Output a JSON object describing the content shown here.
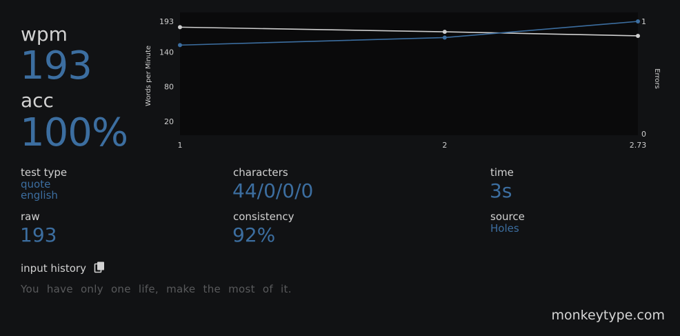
{
  "main": {
    "wpm_label": "wpm",
    "wpm_value": "193",
    "acc_label": "acc",
    "acc_value": "100%"
  },
  "chart_data": {
    "type": "line",
    "x": [
      1,
      2,
      2.73
    ],
    "x_tick_labels": [
      "1",
      "2",
      "2.73"
    ],
    "ylabel": "Words per Minute",
    "y_ticks": [
      "193",
      "140",
      "80",
      "20"
    ],
    "ylim": [
      0,
      200
    ],
    "y2label": "Errors",
    "y2_ticks": [
      "1",
      "0"
    ],
    "y2lim": [
      0,
      1
    ],
    "series": [
      {
        "values": [
          183,
          175,
          168
        ],
        "color": "#cfcfcf"
      },
      {
        "values": [
          152,
          165,
          193
        ],
        "color": "#3c6ea0"
      }
    ]
  },
  "stats": {
    "test_type": {
      "label": "test type",
      "values": [
        "quote",
        "english"
      ]
    },
    "raw": {
      "label": "raw",
      "value": "193"
    },
    "characters": {
      "label": "characters",
      "value": "44/0/0/0"
    },
    "consistency": {
      "label": "consistency",
      "value": "92%"
    },
    "time": {
      "label": "time",
      "value": "3s"
    },
    "source": {
      "label": "source",
      "value": "Holes"
    }
  },
  "input_history": {
    "label": "input history",
    "copy_icon": "copy-icon",
    "words": [
      "You",
      "have",
      "only",
      "one",
      "life,",
      "make",
      "the",
      "most",
      "of",
      "it."
    ]
  },
  "brand": "monkeytype.com",
  "colors": {
    "background": "#111214",
    "accent": "#3c6ea0",
    "text": "#d2d2d2",
    "dim": "#595a5c"
  }
}
